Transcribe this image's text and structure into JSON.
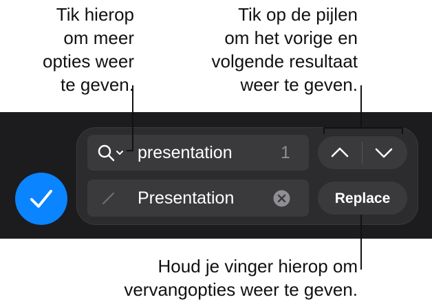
{
  "callouts": {
    "options": "Tik hierop\nom meer\nopties weer\nte geven.",
    "arrows": "Tik op de pijlen\nom het vorige en\nvolgende resultaat\nweer te geven.",
    "replace": "Houd je vinger hierop om\nvervangopties weer te geven."
  },
  "find_bar": {
    "search_value": "presentation",
    "match_count": "1",
    "replace_value": "Presentation",
    "replace_button": "Replace"
  },
  "colors": {
    "toolbar_bg": "#1c1c1e",
    "accent": "#0a84ff",
    "field_bg": "#3a3a3c"
  },
  "icons": {
    "search_options": "magnifier-with-chevron-icon",
    "previous": "chevron-up-icon",
    "next": "chevron-down-icon",
    "clear": "clear-circle-x-icon",
    "replace_field": "pencil-icon",
    "done": "checkmark-icon"
  }
}
